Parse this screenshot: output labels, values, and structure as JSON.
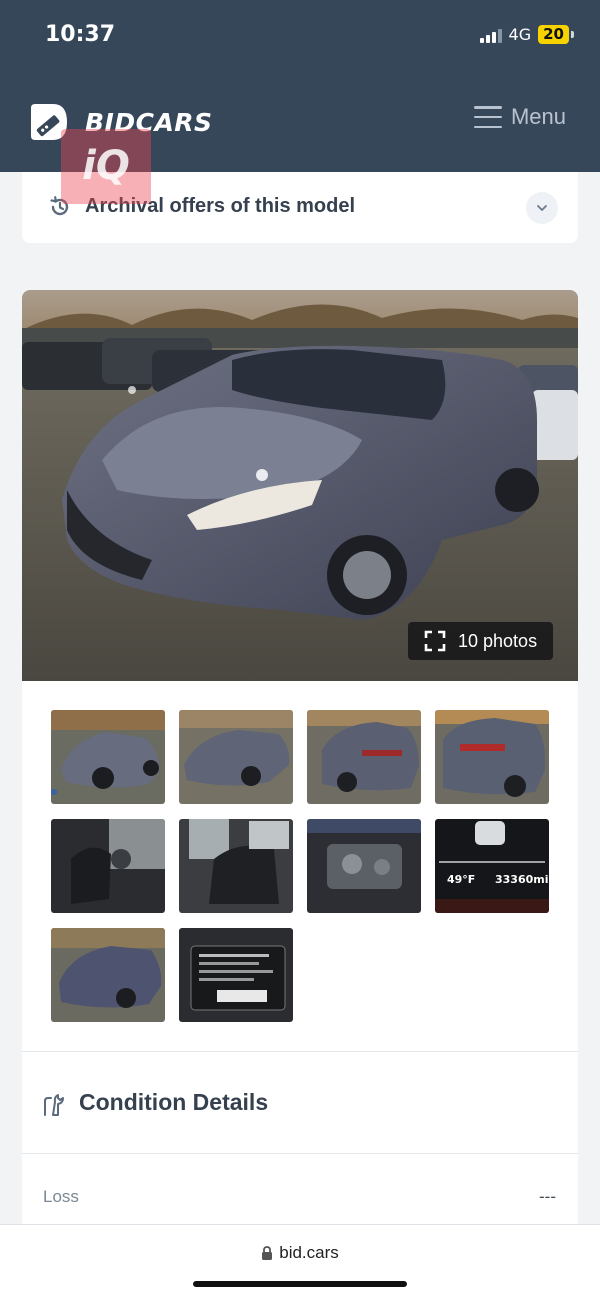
{
  "status_bar": {
    "time": "10:37",
    "network": "4G",
    "battery": "20"
  },
  "header": {
    "logo_text": "BIDCARS",
    "menu_label": "Menu"
  },
  "watermark": {
    "text": "iQ"
  },
  "archival": {
    "title": "Archival offers of this model"
  },
  "gallery": {
    "photo_count_label": "10 photos",
    "thumbnails": [
      "front-left damaged view",
      "front damaged view",
      "rear-left view",
      "rear view",
      "driver seat interior",
      "rear seat interior",
      "engine bay",
      "odometer",
      "front-left angle view",
      "VIN label"
    ],
    "odometer": {
      "temp": "49°F",
      "mileage": "33360mi"
    }
  },
  "condition": {
    "title": "Condition Details",
    "loss_label": "Loss",
    "loss_value": "---"
  },
  "browser": {
    "url": "bid.cars"
  },
  "colors": {
    "header_bg": "#37475a",
    "battery": "#f6d200",
    "page_bg": "#f1f3f5"
  }
}
